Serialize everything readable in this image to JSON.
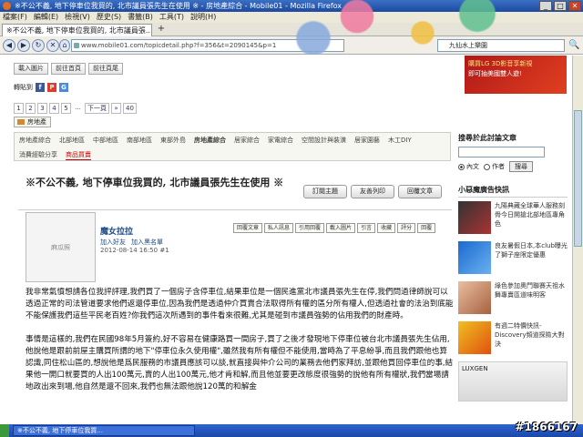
{
  "window": {
    "title": "※不公不義, 地下停車位我買的, 北市議員張先生在使用 ※ - 房地產綜合 - Mobile01 - Mozilla Firefox",
    "buttons": [
      "_",
      "□",
      "✕"
    ]
  },
  "menu": [
    "檔案(F)",
    "編輯(E)",
    "檢視(V)",
    "歷史(S)",
    "書籤(B)",
    "工具(T)",
    "說明(H)"
  ],
  "tab": {
    "label": "※不公不義, 地下停車位我買的, 北市議員張...",
    "new": "+"
  },
  "nav": {
    "back": "◀",
    "forward": "▶",
    "reload": "↻",
    "stop": "✕",
    "home": "⌂",
    "url": "www.mobile01.com/topicdetail.php?f=356&t=2090145&p=1",
    "search": "九仙水上樂園",
    "search_go": "🔍"
  },
  "toolbar": {
    "buttons": [
      "載入圖片",
      "前往首頁",
      "前往頁尾"
    ]
  },
  "share": {
    "label": "轉貼到",
    "icons": [
      "f",
      "P",
      "G"
    ]
  },
  "pager": {
    "pages": [
      "1",
      "2",
      "3",
      "4",
      "5",
      "...",
      "下一頁",
      "»",
      "40"
    ]
  },
  "home_label": "房地產",
  "top_ad": {
    "line1": "購買LG 3D影音享新視",
    "line2": "即可抽美國雙人遊!"
  },
  "categories": {
    "row1": [
      "房地產綜合",
      "北部地區",
      "中部地區",
      "南部地區",
      "東部外島",
      "房地產綜合",
      "居家綜合",
      "家電綜合",
      "空間設計與裝潢",
      "居家園藝",
      "木工DIY"
    ],
    "row2": [
      "消費經驗分享",
      "商品買賣"
    ],
    "active": "商品買賣"
  },
  "thread": {
    "title": "※不公不義, 地下停車位我買的, 北市議員張先生在使用 ※",
    "buttons": [
      "訂閱主題",
      "友善列印",
      "回覆文章"
    ]
  },
  "post": {
    "avatar_alt": "麻瓜照",
    "author": "魔女拉拉",
    "links": [
      "加入好友",
      "加入黑名單"
    ],
    "date": "2012-08-14 16:50",
    "floor": "#1",
    "actions": [
      "回覆文章",
      "私人訊息",
      "引用回覆",
      "載入圖片",
      "引言",
      "收藏",
      "評分",
      "回覆"
    ],
    "paragraphs": [
      "我非常氣憤想請各位我評評理,我們買了一個房子含停車位,結果車位是一個民進黨北市議員張先生在停,我們問過律師說可以透過正常的司法管道要求他們返還停車位,因為我們是透過仲介買賣合法取得所有權的區分所有權人,但透過社會的法治到底能不能保護我們這些平民老百姓?你我們這次所遇到的事件看來很難,尤其是碰到市議員強勢的佔用我們的財產時。",
      "事情是這樣的,我們在民國98年5月簽約,好不容易在健康路買一間房子,買了之後才發現地下停車位被台北市議員張先生佔用,他說他是跟前前屋主購買所謂的地下\"停車位永久使用權\",雖然我有所有權但不能使用,當時為了平息紛爭,而且我們跟他也算認識,同住松山區的,想說他是爲民服務的市議員應該可以談,就直接與仲介公司的業務去他們家拜訪,並跟他買回停車位的事,結果他一開口就要買的人出100萬元,賣的人出100萬元,他才肯和解,而且他並要更改態度很強勢的說他有所有權狀,我們當場請地政出來到場,他自然是還不回來,我們也無法跟他說120萬的和解金"
    ]
  },
  "sidebar": {
    "search_title": "搜尋於此討論文章",
    "radio_text": "內文",
    "radio_author": "作者",
    "search_button": "搜尋",
    "ad_heading": "小惡魔廣告快訊",
    "ads": [
      {
        "text": "九陽典藏全球華人服務刻骨今日開搶北部地區專角色"
      },
      {
        "text": "良友暑假日本,本club曝光了獅子座限定優惠"
      },
      {
        "text": "綠色參加奧門聯賽天祖水舞專賣區道味明客"
      },
      {
        "text": "有週二特價快訊-Discovery頻道探險大對決"
      }
    ],
    "car_ad": "LUXGEN"
  },
  "taskbar": {
    "item": "※不公不義, 地下停車位我買..."
  },
  "watermark": "#1866167",
  "colors": {
    "title_bar": "#1c4aa0",
    "link": "#1a4a8a",
    "red": "#c00000"
  }
}
